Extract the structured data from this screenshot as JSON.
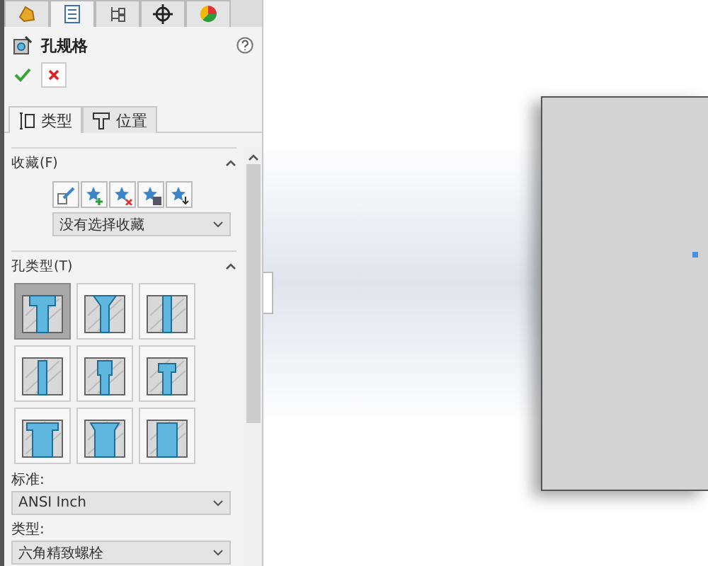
{
  "tabs": [
    {
      "kind": "feature",
      "selected": false
    },
    {
      "kind": "property",
      "selected": true
    },
    {
      "kind": "config",
      "selected": false
    },
    {
      "kind": "target",
      "selected": false
    },
    {
      "kind": "display",
      "selected": false
    }
  ],
  "title": "孔规格",
  "subtabs": [
    {
      "kind": "type",
      "label": "类型",
      "selected": true
    },
    {
      "kind": "position",
      "label": "位置",
      "selected": false
    }
  ],
  "favorites": {
    "title": "收藏(F)",
    "expanded": true,
    "selection": "没有选择收藏"
  },
  "hole_type": {
    "title": "孔类型(T)",
    "expanded": true,
    "types": [
      {
        "kind": "counterbore",
        "selected": true
      },
      {
        "kind": "countersink",
        "selected": false
      },
      {
        "kind": "straight",
        "selected": false
      },
      {
        "kind": "straight-tap",
        "selected": false
      },
      {
        "kind": "tapered-tap",
        "selected": false
      },
      {
        "kind": "legacy",
        "selected": false
      },
      {
        "kind": "counterbore-slot",
        "selected": false
      },
      {
        "kind": "countersink-slot",
        "selected": false
      },
      {
        "kind": "straight-slot",
        "selected": false
      }
    ],
    "standard_label": "标准:",
    "standard": "ANSI Inch",
    "type_label": "类型:",
    "type": "六角精致螺栓"
  }
}
